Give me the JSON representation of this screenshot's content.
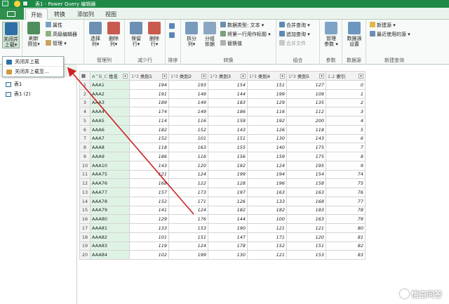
{
  "window": {
    "title": "表1 - Power Query 编辑器"
  },
  "tabs": [
    {
      "label": "开始",
      "active": true
    },
    {
      "label": "转换",
      "active": false
    },
    {
      "label": "添加列",
      "active": false
    },
    {
      "label": "视图",
      "active": false
    }
  ],
  "ribbon": {
    "close": {
      "btn_line1": "关闭并",
      "btn_line2": "上载▾",
      "group_label": ""
    },
    "query": {
      "refresh_line1": "刷新",
      "refresh_line2": "预览▾",
      "properties": "属性",
      "advanced_editor": "高级编辑器",
      "manage": "管理 ▾"
    },
    "manage_cols": {
      "choose_line1": "选择",
      "choose_line2": "列▾",
      "remove_line1": "删除",
      "remove_line2": "列▾",
      "group_label": "管理列"
    },
    "reduce_rows": {
      "keep_line1": "保留",
      "keep_line2": "行▾",
      "remove_line1": "删除",
      "remove_line2": "行▾",
      "group_label": "减少行"
    },
    "sort": {
      "group_label": "排序"
    },
    "transform": {
      "split_line1": "拆分",
      "split_line2": "列▾",
      "group_line1": "分组",
      "group_line2": "依据",
      "datatype": "数据类型: 文本 ▾",
      "first_row": "将第一行用作标题 ▾",
      "replace": "替换值",
      "group_label": "转换"
    },
    "combine": {
      "merge": "合并查询 ▾",
      "append": "追加查询 ▾",
      "merge_files": "合并文件",
      "group_label": "组合"
    },
    "params": {
      "line1": "管理",
      "line2": "参数 ▾",
      "group_label": "参数"
    },
    "datasource": {
      "line1": "数据源",
      "line2": "设置",
      "group_label": "数据源"
    },
    "newquery": {
      "new_source": "新建源 ▾",
      "recent": "最近使用的源 ▾",
      "group_label": "新建查询"
    }
  },
  "close_menu": {
    "items": [
      "关闭并上载",
      "关闭并上载至..."
    ]
  },
  "queries": {
    "items": [
      "表1",
      "表1 (2)"
    ]
  },
  "table": {
    "columns": [
      {
        "type": "A^B_C",
        "name": "姓名"
      },
      {
        "type": "1²3",
        "name": "类别1"
      },
      {
        "type": "1²3",
        "name": "类别2"
      },
      {
        "type": "1²3",
        "name": "类别3"
      },
      {
        "type": "1²3",
        "name": "类别4"
      },
      {
        "type": "1²3",
        "name": "类别5"
      },
      {
        "type": "1.2",
        "name": "索引"
      }
    ],
    "rows": [
      [
        "AAA1",
        194,
        193,
        154,
        151,
        127,
        0
      ],
      [
        "AAA2",
        191,
        149,
        144,
        199,
        109,
        1
      ],
      [
        "AAA3",
        189,
        149,
        183,
        129,
        135,
        2
      ],
      [
        "AAA4",
        174,
        149,
        186,
        116,
        112,
        3
      ],
      [
        "AAA5",
        114,
        116,
        159,
        192,
        200,
        4
      ],
      [
        "AAA6",
        182,
        152,
        143,
        126,
        118,
        5
      ],
      [
        "AAA7",
        152,
        101,
        151,
        130,
        143,
        6
      ],
      [
        "AAA8",
        118,
        163,
        155,
        140,
        175,
        7
      ],
      [
        "AAA9",
        186,
        116,
        156,
        159,
        175,
        8
      ],
      [
        "AAA10",
        143,
        120,
        192,
        124,
        195,
        9
      ],
      [
        "AAA75",
        121,
        124,
        199,
        194,
        154,
        74
      ],
      [
        "AAA76",
        168,
        122,
        128,
        196,
        158,
        75
      ],
      [
        "AAA77",
        157,
        173,
        197,
        163,
        163,
        76
      ],
      [
        "AAA78",
        152,
        171,
        126,
        133,
        168,
        77
      ],
      [
        "AAA79",
        141,
        124,
        182,
        182,
        183,
        78
      ],
      [
        "AAA80",
        129,
        176,
        144,
        100,
        163,
        79
      ],
      [
        "AAA81",
        133,
        153,
        190,
        121,
        121,
        80
      ],
      [
        "AAA82",
        101,
        151,
        147,
        171,
        120,
        81
      ],
      [
        "AAA83",
        119,
        124,
        178,
        152,
        151,
        82
      ],
      [
        "AAA84",
        102,
        199,
        130,
        121,
        153,
        83
      ]
    ]
  },
  "watermark": {
    "text": "悟空问答"
  },
  "colors": {
    "accent": "#1f8a47",
    "selection": "#dff3e5",
    "arrow": "#cc2222"
  }
}
